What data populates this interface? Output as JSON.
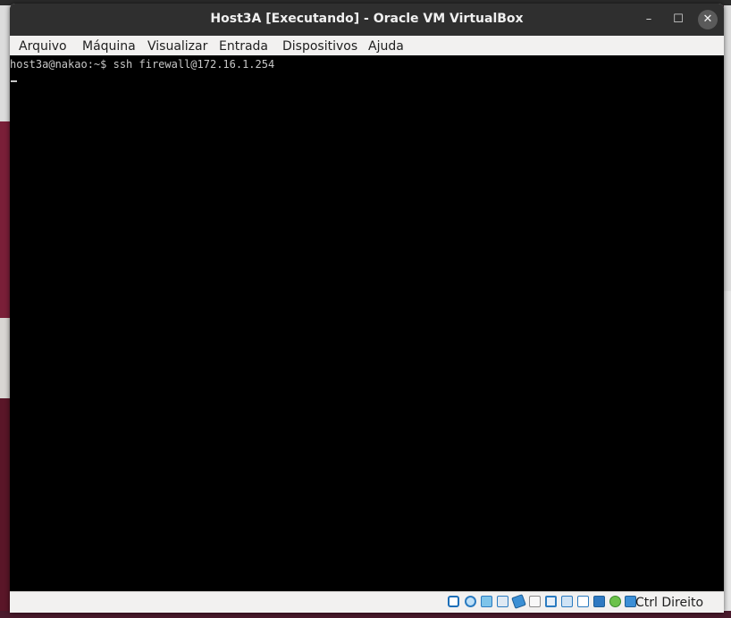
{
  "window": {
    "title": "Host3A [Executando] - Oracle VM VirtualBox",
    "controls": {
      "minimize": "–",
      "maximize": "☐",
      "close": "✕"
    }
  },
  "menu": {
    "items": [
      "Arquivo",
      "Máquina",
      "Visualizar",
      "Entrada",
      "Dispositivos",
      "Ajuda"
    ]
  },
  "console": {
    "prompt_line": "host3a@nakao:~$ ssh firewall@172.16.1.254"
  },
  "statusbar": {
    "icons": [
      "hard-disk-icon",
      "optical-disk-icon",
      "audio-icon",
      "network-icon",
      "usb-icon",
      "shared-folders-icon",
      "display-icon",
      "video-capture-icon",
      "recording-icon",
      "cpu-virtualization-icon",
      "mouse-integration-icon",
      "keyboard-capture-icon"
    ],
    "host_key": "Ctrl Direito"
  }
}
